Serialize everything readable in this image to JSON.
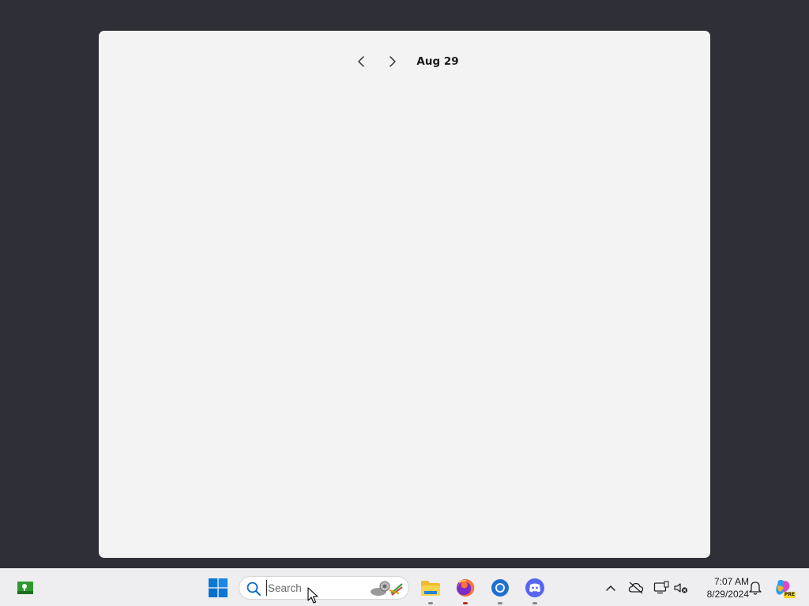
{
  "calendar": {
    "date_label": "Aug 29",
    "prev_icon": "chevron-left-icon",
    "next_icon": "chevron-right-icon"
  },
  "taskbar": {
    "search_placeholder": "Search",
    "apps": [
      {
        "name": "File Explorer",
        "icon": "folder-icon"
      },
      {
        "name": "Firefox",
        "icon": "firefox-icon"
      },
      {
        "name": "Chrome",
        "icon": "chrome-icon"
      },
      {
        "name": "Discord",
        "icon": "discord-icon"
      }
    ],
    "clock_time": "7:07 AM",
    "clock_date": "8/29/2024",
    "copilot_badge": "PRE"
  },
  "colors": {
    "desktop_bg": "#2f2f37",
    "panel_bg": "#f3f3f3",
    "taskbar_bg": "#eeeef0",
    "accent_blue": "#0078d4",
    "running_indicator": "#c42b1c"
  }
}
